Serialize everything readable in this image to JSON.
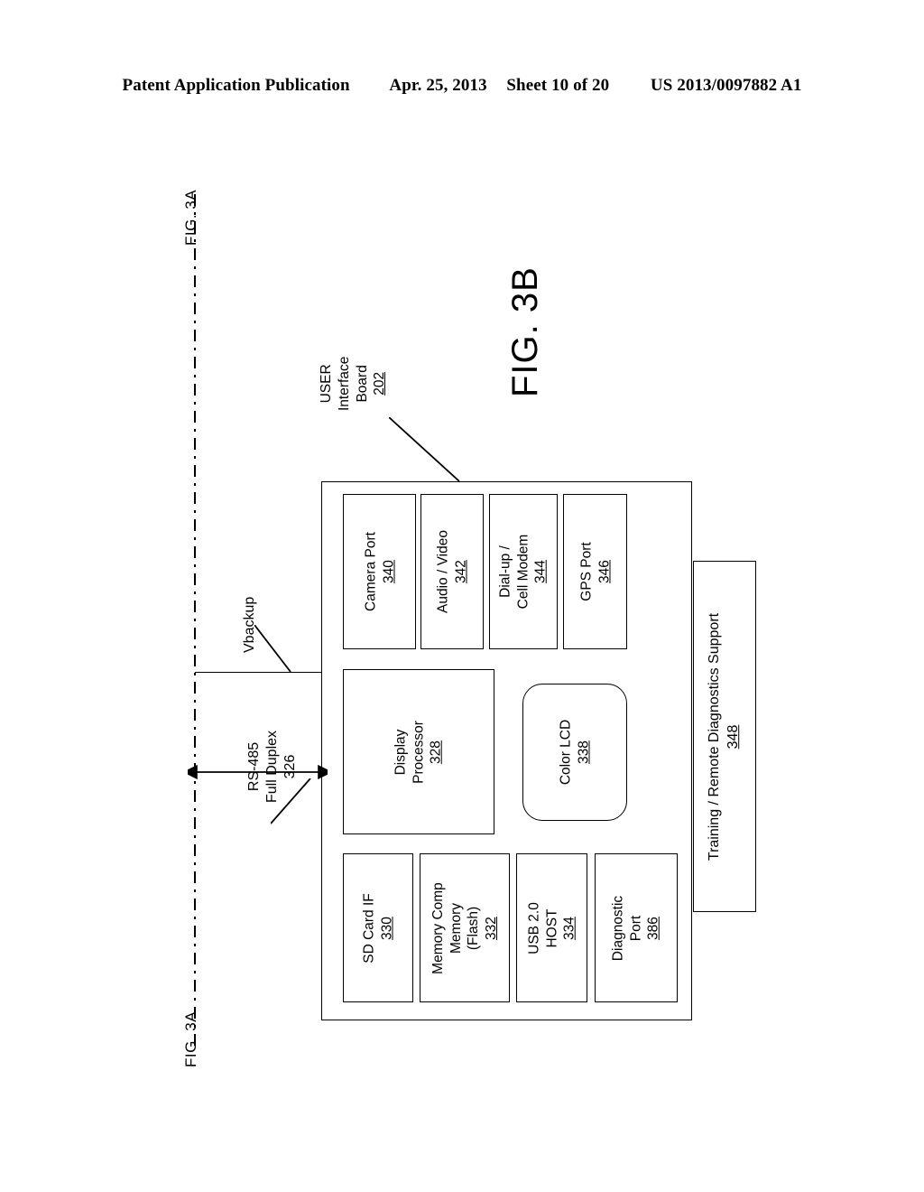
{
  "header": {
    "publication": "Patent Application Publication",
    "date": "Apr. 25, 2013",
    "sheet": "Sheet 10 of 20",
    "patent_number": "US 2013/0097882 A1"
  },
  "figure": {
    "title": "FIG. 3B",
    "continuation_label_top": "FIG. 3A",
    "continuation_label_bottom": "FIG. 3A"
  },
  "callouts": {
    "board": {
      "line1": "USER",
      "line2": "Interface",
      "line3": "Board",
      "ref": "202"
    },
    "vbackup": {
      "label": "Vbackup"
    },
    "rs485": {
      "line1": "RS-485",
      "line2": "Full Duplex",
      "ref": "326"
    }
  },
  "modules": {
    "camera_port": {
      "line1": "Camera Port",
      "ref": "340"
    },
    "audio_video": {
      "line1": "Audio / Video",
      "ref": "342"
    },
    "modem": {
      "line1": "Dial-up /",
      "line2": "Cell Modem",
      "ref": "344"
    },
    "gps_port": {
      "line1": "GPS Port",
      "ref": "346"
    },
    "display_processor": {
      "line1": "Display",
      "line2": "Processor",
      "ref": "328"
    },
    "color_lcd": {
      "line1": "Color LCD",
      "ref": "338"
    },
    "sd_card": {
      "line1": "SD Card IF",
      "ref": "330"
    },
    "flash_memory": {
      "line1": "Memory Comp",
      "line2": "Memory",
      "line3": "(Flash)",
      "ref": "332"
    },
    "usb_host": {
      "line1": "USB 2.0",
      "line2": "HOST",
      "ref": "334"
    },
    "diagnostic_port": {
      "line1": "Diagnostic",
      "line2": "Port",
      "ref": "386"
    },
    "training_support": {
      "line1": "Training / Remote Diagnostics Support",
      "ref": "348"
    }
  },
  "colors": {
    "ink": "#000000",
    "paper": "#ffffff"
  }
}
